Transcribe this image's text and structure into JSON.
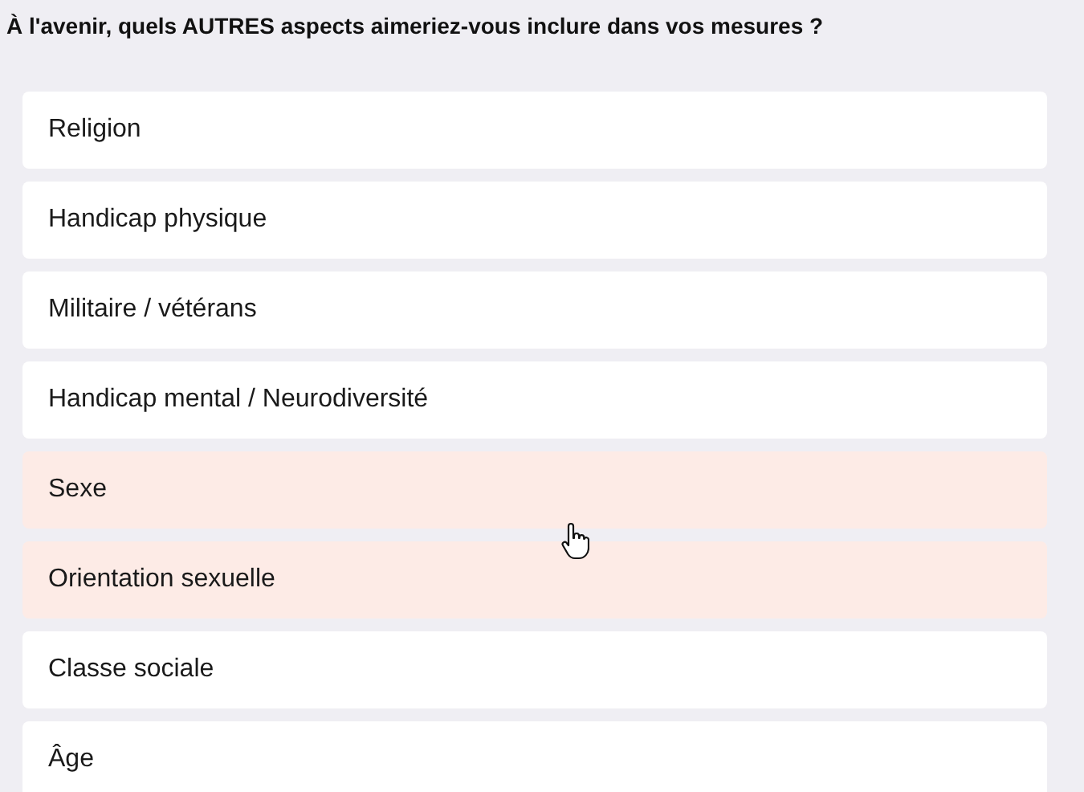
{
  "question": "À l'avenir, quels AUTRES aspects aimeriez-vous inclure dans vos mesures ?",
  "options": [
    {
      "label": "Religion",
      "selected": false
    },
    {
      "label": "Handicap physique",
      "selected": false
    },
    {
      "label": "Militaire / vétérans",
      "selected": false
    },
    {
      "label": "Handicap mental / Neurodiversité",
      "selected": false
    },
    {
      "label": "Sexe",
      "selected": true
    },
    {
      "label": "Orientation sexuelle",
      "selected": true
    },
    {
      "label": "Classe sociale",
      "selected": false
    },
    {
      "label": "Âge",
      "selected": false
    }
  ]
}
